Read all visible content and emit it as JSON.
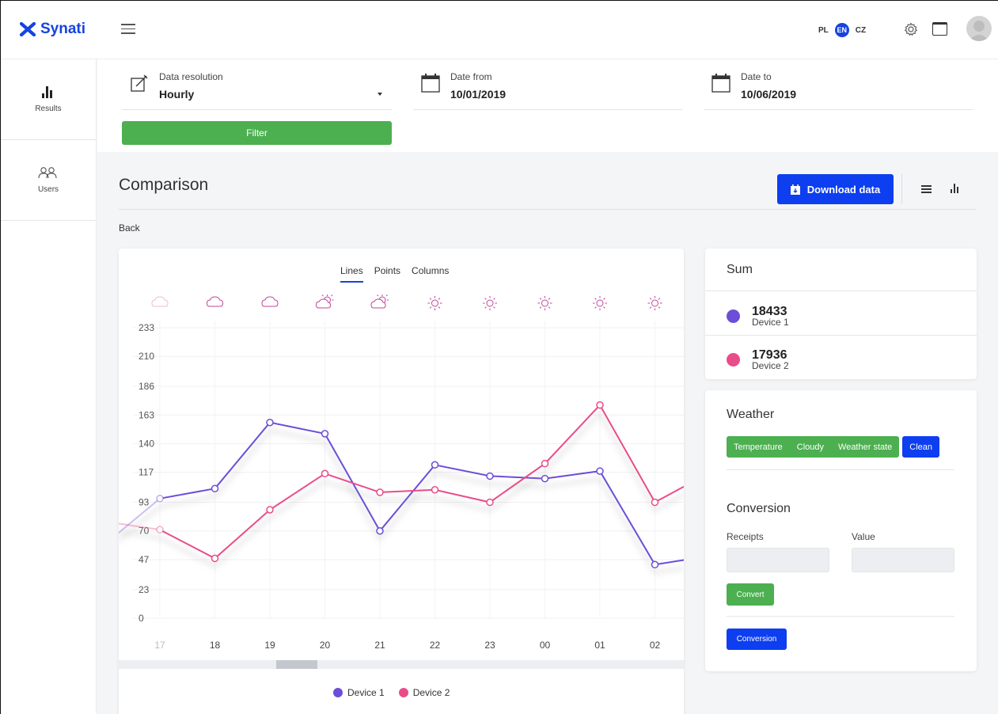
{
  "app": {
    "brand": "Synati"
  },
  "header": {
    "languages": [
      {
        "code": "PL",
        "active": false
      },
      {
        "code": "EN",
        "active": true
      },
      {
        "code": "CZ",
        "active": false
      }
    ],
    "icons": [
      "menu-icon",
      "gear-icon",
      "window-icon",
      "avatar"
    ]
  },
  "sidebar": {
    "items": [
      {
        "label": "Results",
        "icon": "bar-chart-icon"
      },
      {
        "label": "Users",
        "icon": "users-icon"
      }
    ]
  },
  "filters": {
    "resolution": {
      "label": "Data resolution",
      "value": "Hourly"
    },
    "date_from": {
      "label": "Date from",
      "value": "10/01/2019"
    },
    "date_to": {
      "label": "Date to",
      "value": "10/06/2019"
    },
    "filter_label": "Filter"
  },
  "page": {
    "title": "Comparison",
    "download_label": "Download data",
    "back_label": "Back"
  },
  "chart": {
    "tabs": [
      {
        "label": "Lines",
        "active": true
      },
      {
        "label": "Points",
        "active": false
      },
      {
        "label": "Columns",
        "active": false
      }
    ],
    "scroll_position": 0.3
  },
  "chart_data": {
    "type": "line",
    "categories": [
      "17",
      "18",
      "19",
      "20",
      "21",
      "22",
      "23",
      "00",
      "01",
      "02"
    ],
    "weather_icons": [
      "cloud",
      "cloud",
      "cloud",
      "partly-sunny",
      "partly-sunny",
      "sun",
      "sun",
      "sun",
      "sun",
      "sun"
    ],
    "y_ticks": [
      0,
      23,
      47,
      70,
      93,
      117,
      140,
      163,
      186,
      210,
      233
    ],
    "ylim": [
      0,
      233
    ],
    "grid": true,
    "legend_position": "bottom",
    "series": [
      {
        "name": "Device 1",
        "color": "#6c4ed9",
        "values": [
          96,
          104,
          157,
          148,
          70,
          123,
          114,
          112,
          118,
          43
        ],
        "lead_in": 68,
        "lead_out": 50
      },
      {
        "name": "Device 2",
        "color": "#ea4c89",
        "values": [
          71,
          48,
          87,
          116,
          101,
          103,
          93,
          124,
          171,
          93
        ],
        "lead_in": 76,
        "lead_out": 117
      }
    ]
  },
  "sum": {
    "title": "Sum",
    "items": [
      {
        "value": "18433",
        "name": "Device 1",
        "color": "#6c4ed9"
      },
      {
        "value": "17936",
        "name": "Device 2",
        "color": "#ea4c89"
      }
    ]
  },
  "weather": {
    "title": "Weather",
    "buttons": [
      "Temperature",
      "Cloudy",
      "Weather state"
    ],
    "clean_label": "Clean"
  },
  "conversion": {
    "title": "Conversion",
    "receipts_label": "Receipts",
    "value_label": "Value",
    "receipts_value": "",
    "value_value": "",
    "convert_label": "Convert",
    "conversion_label": "Conversion"
  }
}
